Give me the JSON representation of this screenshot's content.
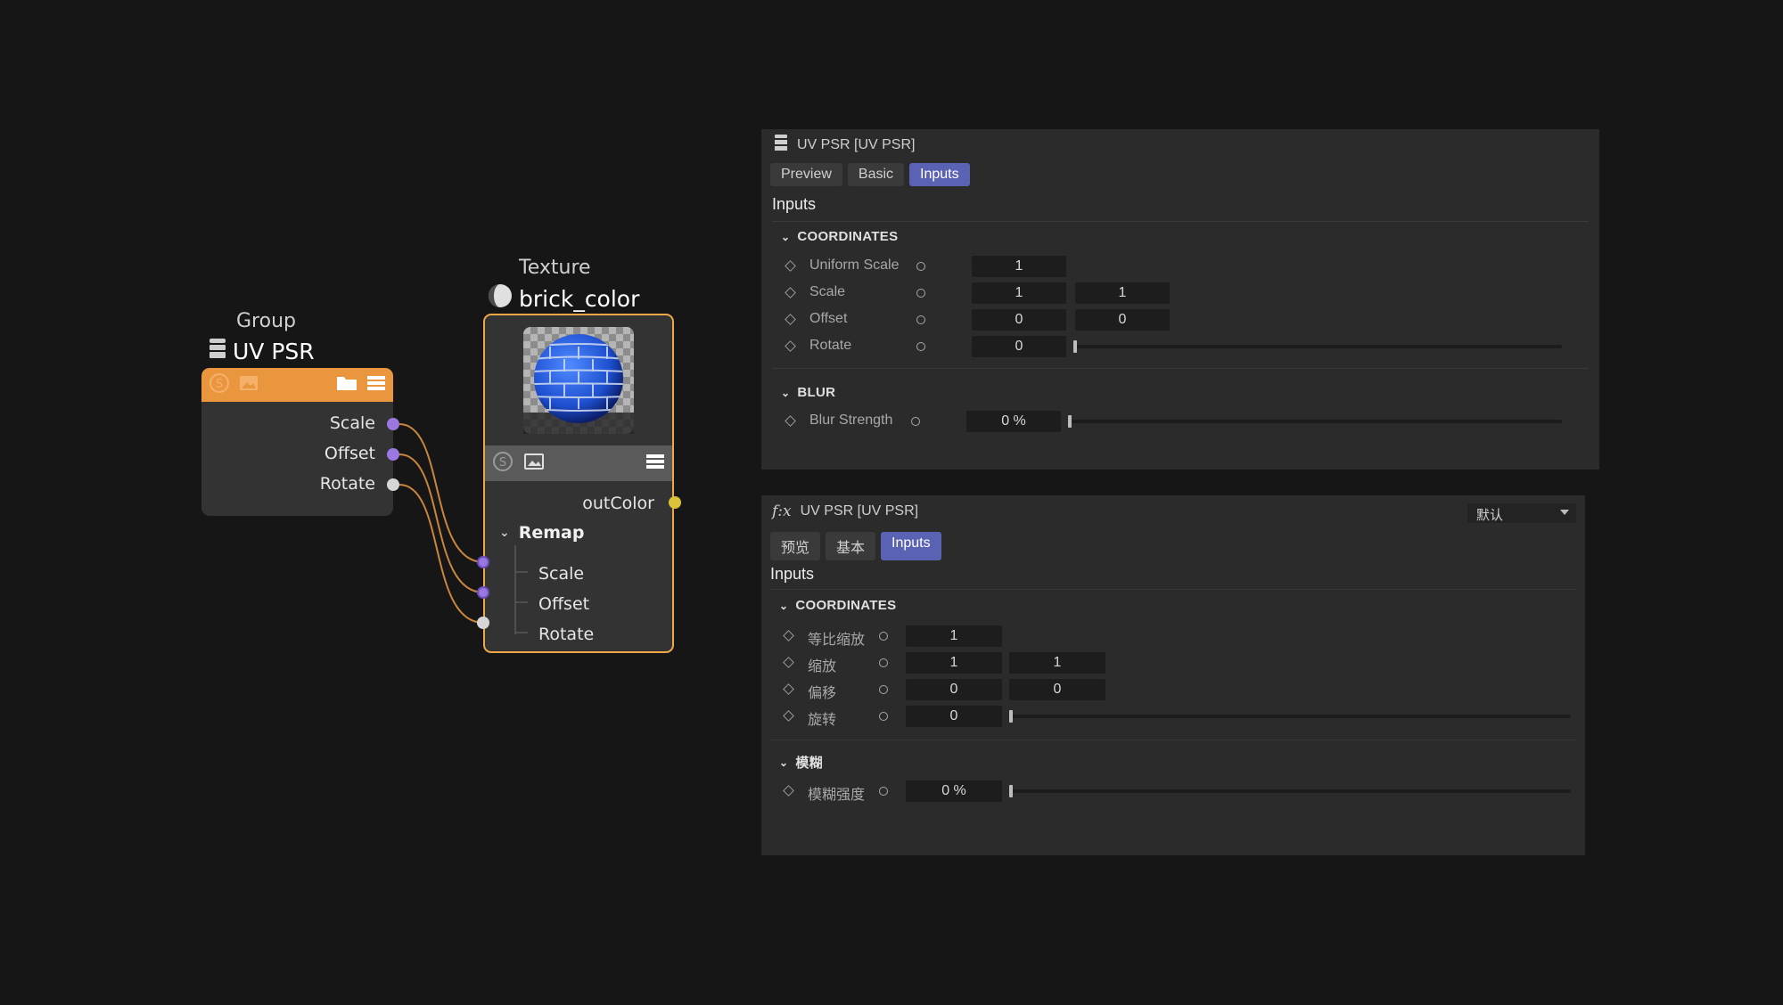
{
  "colors": {
    "background": "#161616",
    "group_header": "#e9963f",
    "node_body": "#333333",
    "texture_border": "#f0a748",
    "port_purple": "#9b77e0",
    "port_white": "#d6d6d6",
    "port_yellow": "#d9c23a",
    "wire": "#c9853e",
    "tab_active": "#5a62b3",
    "panel_bg": "#2b2b2b"
  },
  "group_node": {
    "caption": "Group",
    "title": "UV PSR",
    "header_icons": [
      "s-badge-icon",
      "image-icon",
      "folder-icon",
      "menu-icon"
    ],
    "ports": [
      {
        "label": "Scale",
        "color": "purple"
      },
      {
        "label": "Offset",
        "color": "purple"
      },
      {
        "label": "Rotate",
        "color": "white"
      }
    ]
  },
  "texture_node": {
    "caption": "Texture",
    "title": "brick_color",
    "output_label": "outColor",
    "section_label": "Remap",
    "inputs": [
      "Scale",
      "Offset",
      "Rotate"
    ]
  },
  "panel_en": {
    "title": "UV PSR  [UV PSR]",
    "tabs": [
      "Preview",
      "Basic",
      "Inputs"
    ],
    "active_tab": "Inputs",
    "heading": "Inputs",
    "section_coords": "COORDINATES",
    "section_blur": "BLUR",
    "params": {
      "uniform_scale": {
        "label": "Uniform Scale",
        "value": "1"
      },
      "scale": {
        "label": "Scale",
        "value1": "1",
        "value2": "1"
      },
      "offset": {
        "label": "Offset",
        "value1": "0",
        "value2": "0"
      },
      "rotate": {
        "label": "Rotate",
        "value": "0"
      },
      "blur_strength": {
        "label": "Blur Strength",
        "value": "0 %"
      }
    }
  },
  "panel_cn": {
    "title_prefix": "f:x",
    "title": "UV PSR  [UV PSR]",
    "dropdown_value": "默认",
    "tabs": [
      "预览",
      "基本",
      "Inputs"
    ],
    "active_tab": "Inputs",
    "heading": "Inputs",
    "section_coords": "COORDINATES",
    "section_blur": "模糊",
    "params": {
      "uniform_scale": {
        "label": "等比缩放",
        "value": "1"
      },
      "scale": {
        "label": "缩放",
        "value1": "1",
        "value2": "1"
      },
      "offset": {
        "label": "偏移",
        "value1": "0",
        "value2": "0"
      },
      "rotate": {
        "label": "旋转",
        "value": "0"
      },
      "blur_strength": {
        "label": "模糊强度",
        "value": "0 %"
      }
    }
  }
}
